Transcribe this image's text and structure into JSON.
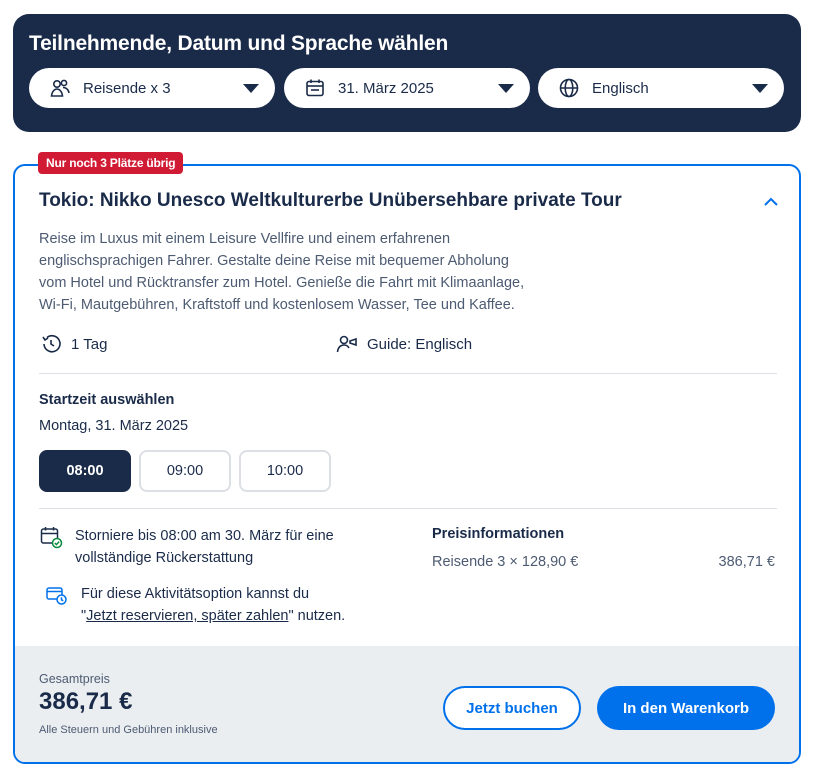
{
  "selector": {
    "title": "Teilnehmende, Datum und Sprache wählen",
    "travelers": {
      "label": "Reisende x 3",
      "icon": "travelers-icon"
    },
    "date": {
      "label": "31. März 2025",
      "icon": "calendar-icon"
    },
    "language": {
      "label": "Englisch",
      "icon": "globe-icon"
    }
  },
  "activity": {
    "badge": "Nur noch 3 Plätze übrig",
    "title": "Tokio: Nikko Unesco Weltkulturerbe Unübersehbare private Tour",
    "description_lines": [
      "Reise im Luxus mit einem Leisure Vellfire und einem erfahrenen",
      "englischsprachigen Fahrer. Gestalte deine Reise mit bequemer Abholung",
      "vom Hotel und Rücktransfer zum Hotel. Genieße die Fahrt mit Klimaanlage,",
      "Wi-Fi, Mautgebühren, Kraftstoff und kostenlosem Wasser, Tee und Kaffee."
    ],
    "duration": "1 Tag",
    "guide": "Guide: Englisch",
    "start_time_label": "Startzeit auswählen",
    "start_date": "Montag, 31. März 2025",
    "time_slots": [
      "08:00",
      "09:00",
      "10:00"
    ],
    "selected_slot": "08:00",
    "cancellation": {
      "line1": "Storniere bis 08:00 am 30. März für eine",
      "line2": "vollständige Rückerstattung"
    },
    "reserve": {
      "line1": "Für diese Aktivitätsoption kannst du",
      "quote_open": "\"",
      "link": "Jetzt reservieren, später zahlen",
      "quote_close": "\" nutzen."
    },
    "price_info": {
      "heading": "Preisinformationen",
      "line": "Reisende 3 × 128,90 €",
      "total": "386,71 €"
    }
  },
  "footer": {
    "total_label": "Gesamtpreis",
    "total_value": "386,71 €",
    "tax_note": "Alle Steuern und Gebühren inklusive",
    "book_button": "Jetzt buchen",
    "cart_button": "In den Warenkorb"
  },
  "colors": {
    "navy": "#1a2b49",
    "accent_blue": "#0071eb",
    "badge_red": "#d11a34",
    "footer_bg": "#ebeef1"
  }
}
